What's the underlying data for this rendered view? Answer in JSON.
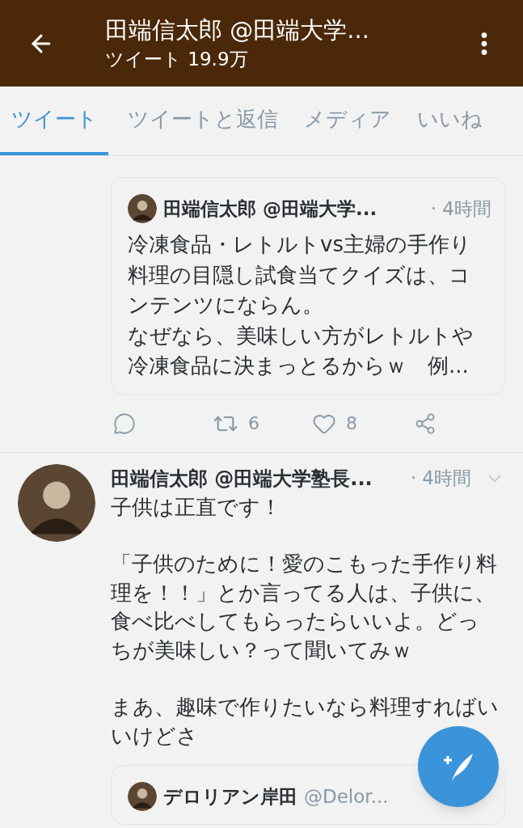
{
  "header": {
    "title": "田端信太郎 @田端大学...",
    "subtitle": "ツイート 19.9万"
  },
  "tabs": [
    {
      "label": "ツイート",
      "selected": true
    },
    {
      "label": "ツイートと返信",
      "selected": false
    },
    {
      "label": "メディア",
      "selected": false
    },
    {
      "label": "いいね",
      "selected": false
    }
  ],
  "timeline": [
    {
      "kind": "quote",
      "quote": {
        "author": "田端信太郎 @田端大学...",
        "time": "· 4時間",
        "paragraphs": [
          "冷凍食品・レトルトvs主婦の手作り料理の目隠し試食当てクイズは、コンテンツにならん。",
          "なぜなら、美味しい方がレトルトや冷凍食品に決まっとるからｗ　例..."
        ]
      },
      "retweet_count": "6",
      "like_count": "8"
    },
    {
      "kind": "tweet",
      "author": "田端信太郎 @田端大学塾長...",
      "time": "· 4時間",
      "paragraphs": [
        "子供は正直です！",
        "「子供のために！愛のこもった手作り料理を！！」とか言ってる人は、子供に、食べ比べしてもらったらいいよ。どっちが美味しい？って聞いてみｗ",
        "まあ、趣味で作りたいなら料理すればいいけどさ"
      ],
      "quote": {
        "author": "デロリアン岸田",
        "handle": "@Delor..."
      }
    }
  ]
}
